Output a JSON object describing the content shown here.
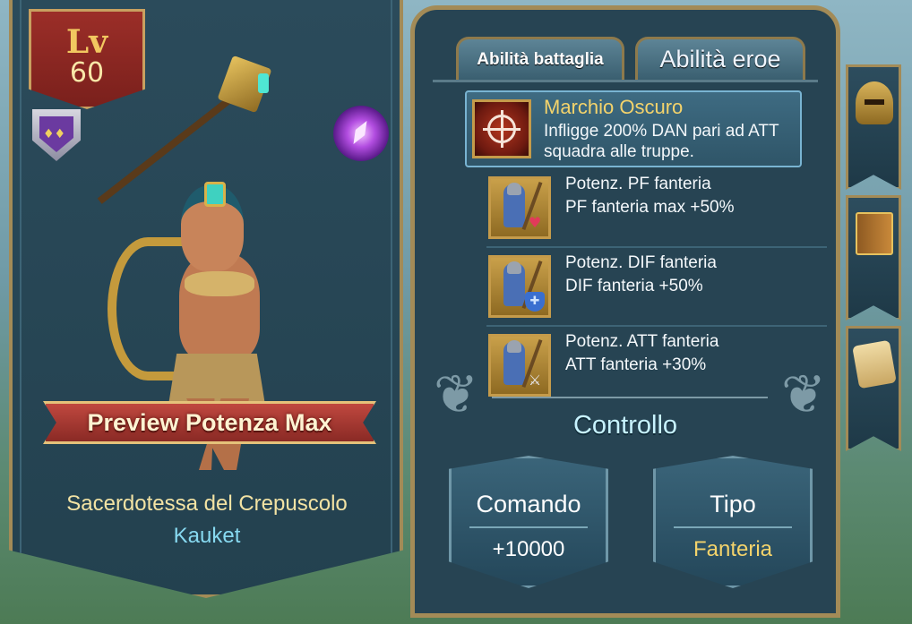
{
  "hero": {
    "level_label": "Lv",
    "level": "60",
    "preview_button": "Preview Potenza Max",
    "title": "Sacerdotessa del Crepuscolo",
    "name": "Kauket"
  },
  "tabs": {
    "battle": "Abilità battaglia",
    "hero": "Abilità eroe"
  },
  "main_skill": {
    "name": "Marchio Oscuro",
    "description": "Infligge 200% DAN pari ad ATT squadra alle truppe.",
    "icon": "crosshair-icon"
  },
  "skills": [
    {
      "name": "Potenz. PF fanteria",
      "effect": "PF fanteria max +50%",
      "icon": "infantry-hp-icon"
    },
    {
      "name": "Potenz. DIF fanteria",
      "effect": "DIF fanteria +50%",
      "icon": "infantry-def-icon"
    },
    {
      "name": "Potenz. ATT fanteria",
      "effect": "ATT fanteria +30%",
      "icon": "infantry-atk-icon"
    }
  ],
  "control": {
    "title": "Controllo",
    "command_label": "Comando",
    "command_value": "+10000",
    "type_label": "Tipo",
    "type_value": "Fanteria"
  },
  "side_tabs": [
    "helmet-icon",
    "book-icon",
    "scroll-icon"
  ],
  "colors": {
    "gold": "#f4d36b",
    "panel": "#274453",
    "ribbon": "#a8372f",
    "border": "#a38b57"
  }
}
